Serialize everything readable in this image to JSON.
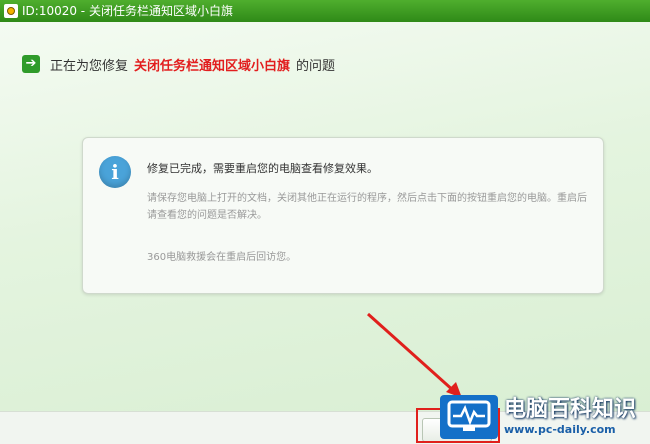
{
  "window": {
    "title": "ID:10020 - 关闭任务栏通知区域小白旗"
  },
  "header": {
    "prefix": "正在为您修复",
    "target": "关闭任务栏通知区域小白旗",
    "suffix": "的问题"
  },
  "panel": {
    "title": "修复已完成，需要重启您的电脑查看修复效果。",
    "body": "请保存您电脑上打开的文档，关闭其他正在运行的程序，然后点击下面的按钮重启您的电脑。重启后请查看您的问题是否解决。",
    "note": "360电脑救援会在重启后回访您。"
  },
  "footer": {
    "restart_label": ""
  },
  "watermark": {
    "title": "电脑百科知识",
    "url": "www.pc-daily.com"
  },
  "colors": {
    "titlebar": "#3b9a22",
    "highlight": "#e21e1e",
    "annotation": "#e0201c",
    "info": "#4aa3d9"
  }
}
